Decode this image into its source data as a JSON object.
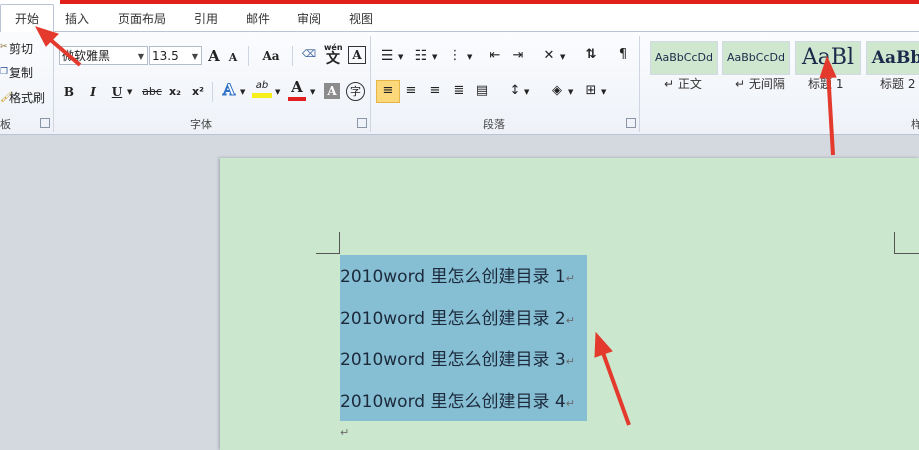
{
  "tabs": [
    {
      "label": "开始"
    },
    {
      "label": "插入"
    },
    {
      "label": "页面布局"
    },
    {
      "label": "引用"
    },
    {
      "label": "邮件"
    },
    {
      "label": "审阅"
    },
    {
      "label": "视图"
    }
  ],
  "clipboard": {
    "cut": "剪切",
    "copy": "复制",
    "format_painter": "格式刷",
    "group_label": "板"
  },
  "font": {
    "font_name": "微软雅黑",
    "font_size": "13.5",
    "group_label": "字体",
    "grow_label": "A",
    "shrink_label": "A",
    "case_label": "Aa",
    "bold": "B",
    "italic": "I",
    "underline": "U",
    "strike": "abc",
    "subscript": "x₂",
    "superscript": "x²",
    "text_effect": "A",
    "highlight": "ab",
    "font_color": "A",
    "char_shading": "A",
    "enclose": "字",
    "phonetic": "wén",
    "phonetic_char": "文",
    "char_border": "A"
  },
  "paragraph": {
    "group_label": "段落"
  },
  "styles": {
    "items": [
      {
        "preview": "AaBbCcDd",
        "label": "↵ 正文"
      },
      {
        "preview": "AaBbCcDd",
        "label": "↵ 无间隔"
      },
      {
        "preview": "AaBl",
        "label": "标题 1"
      },
      {
        "preview": "AaBb",
        "label": "标题 2"
      }
    ],
    "group_label": "样"
  },
  "document": {
    "lines": [
      "2010word 里怎么创建目录 1",
      "2010word 里怎么创建目录 2",
      "2010word 里怎么创建目录 3",
      "2010word 里怎么创建目录 4"
    ],
    "para_mark": "↵"
  },
  "colors": {
    "accent_red": "#e0201a",
    "page_bg": "#cbe8ce",
    "selection": "#86bfd4"
  }
}
